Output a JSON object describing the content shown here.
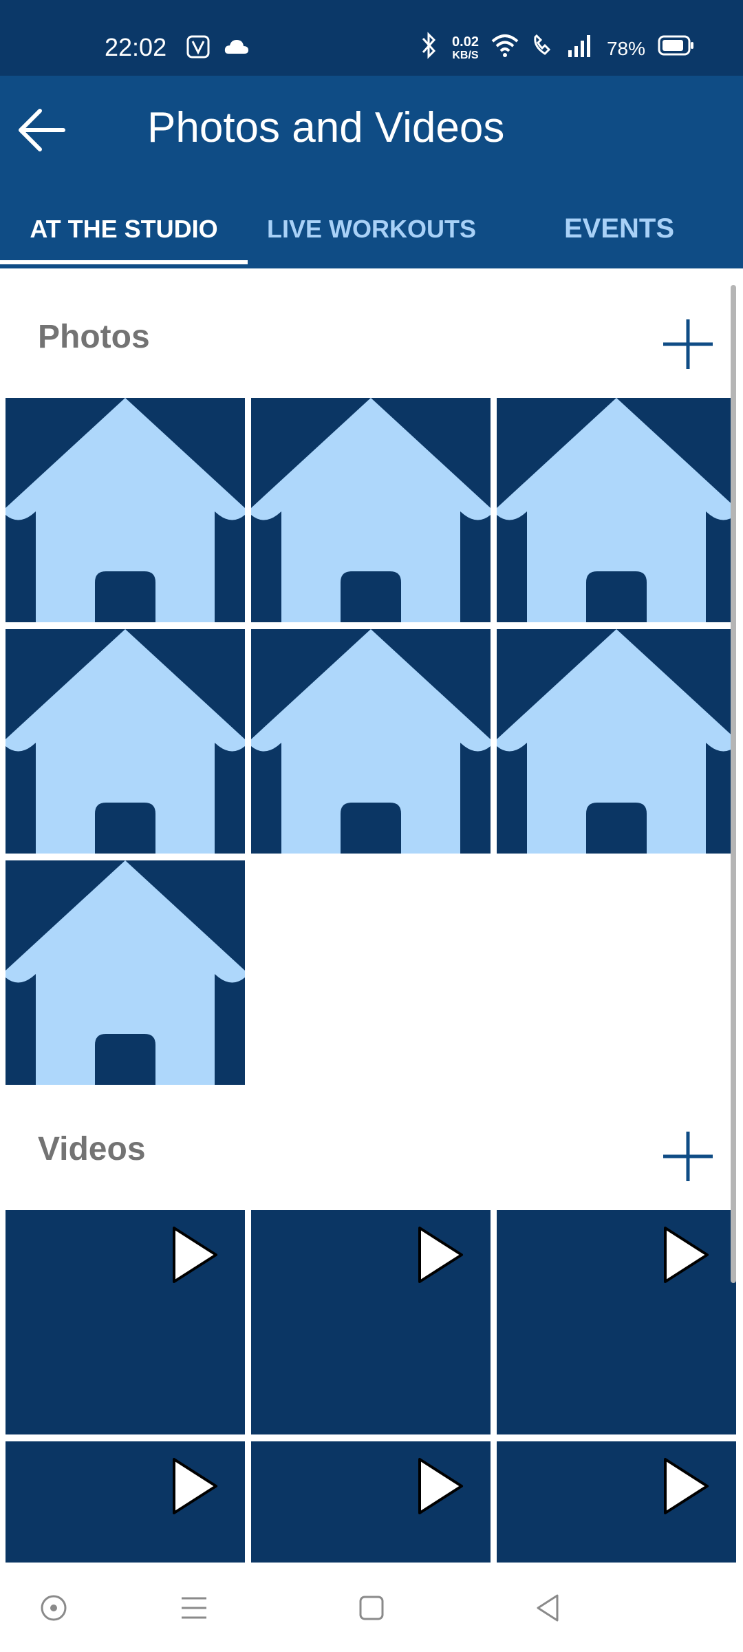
{
  "status": {
    "time": "22:02",
    "net_speed_value": "0.02",
    "net_speed_unit": "KB/S",
    "battery": "78%"
  },
  "header": {
    "title": "Photos and Videos"
  },
  "tabs": [
    {
      "label": "AT THE STUDIO",
      "active": true
    },
    {
      "label": "LIVE WORKOUTS",
      "active": false
    },
    {
      "label": "EVENTS",
      "active": false
    }
  ],
  "sections": {
    "photos": {
      "title": "Photos",
      "count": 7
    },
    "videos": {
      "title": "Videos",
      "count": 6
    }
  },
  "colors": {
    "appbar": "#0f4c85",
    "statusbar": "#0b3868",
    "tile_bg": "#0b3664",
    "house": "#aed7fb",
    "tab_inactive": "#a9d1f7",
    "section_title": "#737373"
  }
}
